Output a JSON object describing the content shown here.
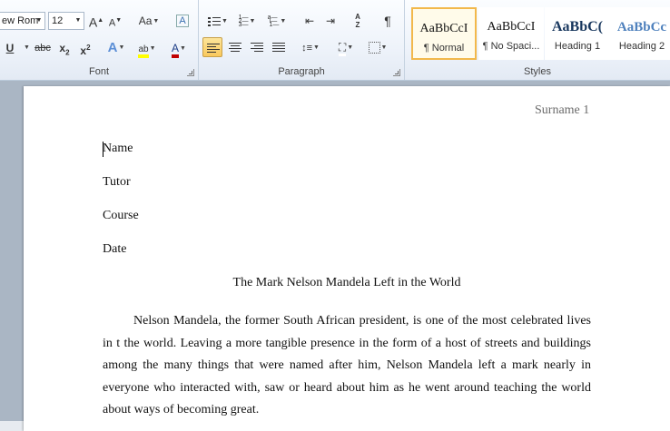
{
  "ribbon": {
    "font": {
      "font_name": "ew Rom",
      "font_size": "12",
      "grow_font": "A",
      "shrink_font": "A",
      "change_case": "Aa",
      "clear_format": "A",
      "underline": "U",
      "strikethrough": "abc",
      "subscript": "x",
      "superscript": "x",
      "sub_mark": "2",
      "sup_mark": "2",
      "text_effects": "A",
      "highlight": "ab",
      "font_color": "A",
      "label": "Font"
    },
    "paragraph": {
      "show_marks": "¶",
      "sort": "A Z",
      "label": "Paragraph"
    },
    "styles": {
      "items": [
        {
          "sample": "AaBbCcI",
          "name": "¶ Normal"
        },
        {
          "sample": "AaBbCcI",
          "name": "¶ No Spaci..."
        },
        {
          "sample": "AaBbC(",
          "name": "Heading 1"
        },
        {
          "sample": "AaBbCc",
          "name": "Heading 2"
        }
      ],
      "label": "Styles"
    }
  },
  "document": {
    "header": "Surname 1",
    "lines": [
      "Name",
      "Tutor",
      "Course",
      "Date"
    ],
    "title": "The Mark Nelson Mandela Left in the World",
    "paragraph": "Nelson Mandela, the former South African president, is one of the most celebrated lives in t the world. Leaving a more tangible presence in the form of a host of streets and buildings among the many things that were named after him, Nelson Mandela left a mark nearly in everyone who interacted with, saw or heard about him as he went around teaching the world about ways of becoming great."
  },
  "colors": {
    "accent": "#f2b84b",
    "heading": "#17365d",
    "heading2": "#4f81bd",
    "font_color": "#c00000",
    "highlight": "#ffff00"
  }
}
